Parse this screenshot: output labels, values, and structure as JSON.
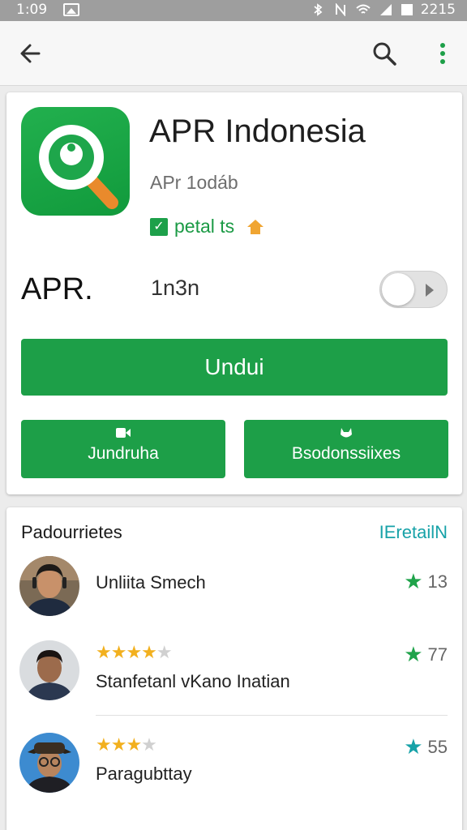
{
  "status_bar": {
    "time": "1:09",
    "right_text": "2215"
  },
  "app": {
    "title": "APR Indonesia",
    "developer": "APr 1odáb",
    "badge_text": "petal ts",
    "apr_label": "APR.",
    "apr_value": "1n3n",
    "install_button": "Undui",
    "button_left": "Jundruha",
    "button_right": "Bsodonssiixes"
  },
  "reviews": {
    "header": "Padourrietes",
    "more_link": "IEretailN",
    "items": [
      {
        "name": "Unliita Smech",
        "score": "13",
        "star_color": "#1fa34a",
        "stars_filled": null
      },
      {
        "name": "Stanfetanl vKano Inatian",
        "score": "77",
        "star_color": "#1fa34a",
        "stars_filled": 3.5
      },
      {
        "name": "Paragubttay",
        "score": "55",
        "star_color": "#17a2a8",
        "stars_filled": 3
      }
    ]
  },
  "colors": {
    "accent": "#1d9f48",
    "link": "#17a2a8",
    "star": "#f2b01e"
  },
  "icons": {
    "back": "arrow-left-icon",
    "search": "search-icon",
    "more": "more-vert-icon",
    "badge": "check-icon",
    "house": "house-icon"
  }
}
